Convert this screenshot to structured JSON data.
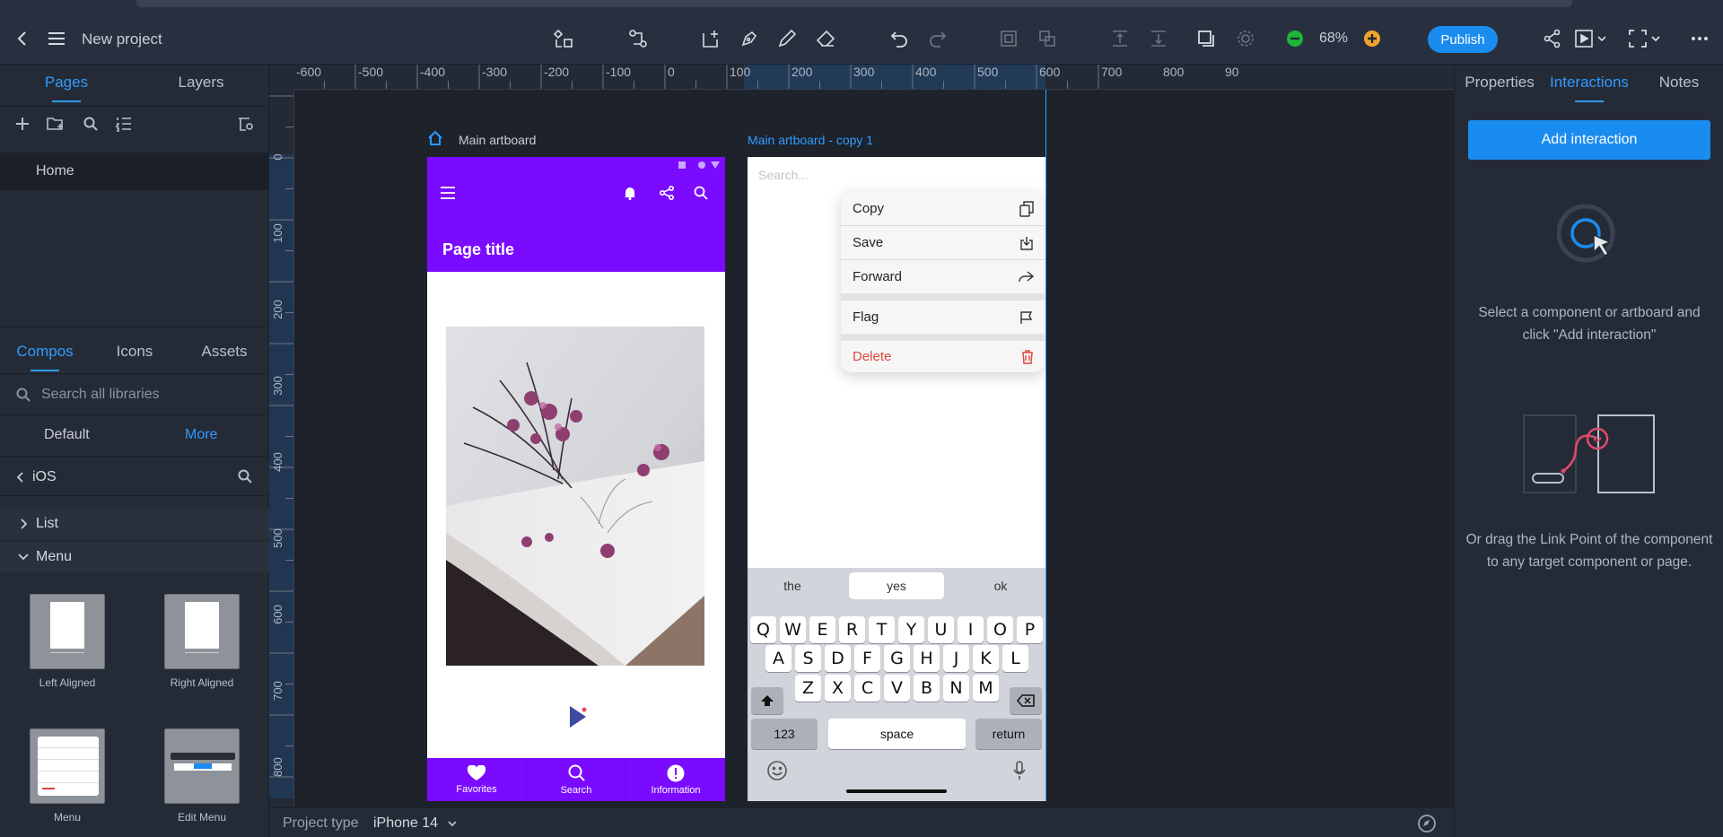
{
  "app": {
    "project_title": "New project",
    "zoom": "68%",
    "publish_label": "Publish"
  },
  "colors": {
    "accent": "#2f9bff",
    "primary_button": "#1a8cf0",
    "artboard_brand": "#7a0bff",
    "delete_red": "#e0473a"
  },
  "toolbar_icons": [
    "back-icon",
    "menu-icon",
    "component-icon",
    "link-icon",
    "add-artboard-icon",
    "pen-icon",
    "pencil-icon",
    "eraser-icon",
    "undo-icon",
    "redo-icon",
    "group-icon",
    "ungroup-icon",
    "align-top-icon",
    "align-bottom-icon",
    "resize-icon",
    "settings-icon",
    "zoom-out-icon",
    "zoom-in-icon",
    "share-icon",
    "preview-icon",
    "fullscreen-icon",
    "more-icon"
  ],
  "left_panel": {
    "tabs": [
      "Pages",
      "Layers"
    ],
    "active_tab": "Pages",
    "pages": [
      "Home"
    ],
    "library_tabs": [
      "Compos",
      "Icons",
      "Assets"
    ],
    "library_active": "Compos",
    "search_placeholder": "Search all libraries",
    "default_label": "Default",
    "more_label": "More",
    "ios_label": "iOS",
    "groups": [
      "List",
      "Menu"
    ],
    "components": [
      "Left Aligned",
      "Right Aligned",
      "Menu",
      "Edit Menu"
    ]
  },
  "canvas": {
    "ruler_top_labels": [
      "-600",
      "-500",
      "-400",
      "-300",
      "-200",
      "-100",
      "0",
      "100",
      "200",
      "300",
      "400",
      "500",
      "600",
      "700",
      "800",
      "90"
    ],
    "ruler_left_labels": [
      "0",
      "100",
      "200",
      "300",
      "400",
      "500",
      "600",
      "700",
      "800"
    ],
    "artboard1_label": "Main artboard",
    "artboard2_label": "Main artboard - copy 1",
    "project_type_label": "Project type",
    "project_type_value": "iPhone 14"
  },
  "artboard1": {
    "page_title": "Page title",
    "nav": [
      {
        "label": "Favorites",
        "icon": "heart-icon"
      },
      {
        "label": "Search",
        "icon": "search-icon"
      },
      {
        "label": "Information",
        "icon": "info-icon"
      }
    ]
  },
  "artboard2": {
    "search_placeholder": "Search...",
    "menu": [
      {
        "label": "Copy",
        "icon": "copy-icon"
      },
      {
        "label": "Save",
        "icon": "save-icon"
      },
      {
        "label": "Forward",
        "icon": "forward-icon"
      },
      {
        "label": "Flag",
        "icon": "flag-icon"
      },
      {
        "label": "Delete",
        "icon": "trash-icon"
      }
    ],
    "suggestions": [
      "the",
      "yes",
      "ok"
    ],
    "keyboard_rows": [
      [
        "Q",
        "W",
        "E",
        "R",
        "T",
        "Y",
        "U",
        "I",
        "O",
        "P"
      ],
      [
        "A",
        "S",
        "D",
        "F",
        "G",
        "H",
        "J",
        "K",
        "L"
      ],
      [
        "Z",
        "X",
        "C",
        "V",
        "B",
        "N",
        "M"
      ]
    ],
    "key_123": "123",
    "key_space": "space",
    "key_return": "return"
  },
  "right_panel": {
    "tabs": [
      "Properties",
      "Interactions",
      "Notes"
    ],
    "active_tab": "Interactions",
    "add_interaction_label": "Add interaction",
    "hint1": "Select a component or artboard and click \"Add interaction\"",
    "hint2": "Or drag the Link Point of the component to any target component or page."
  }
}
